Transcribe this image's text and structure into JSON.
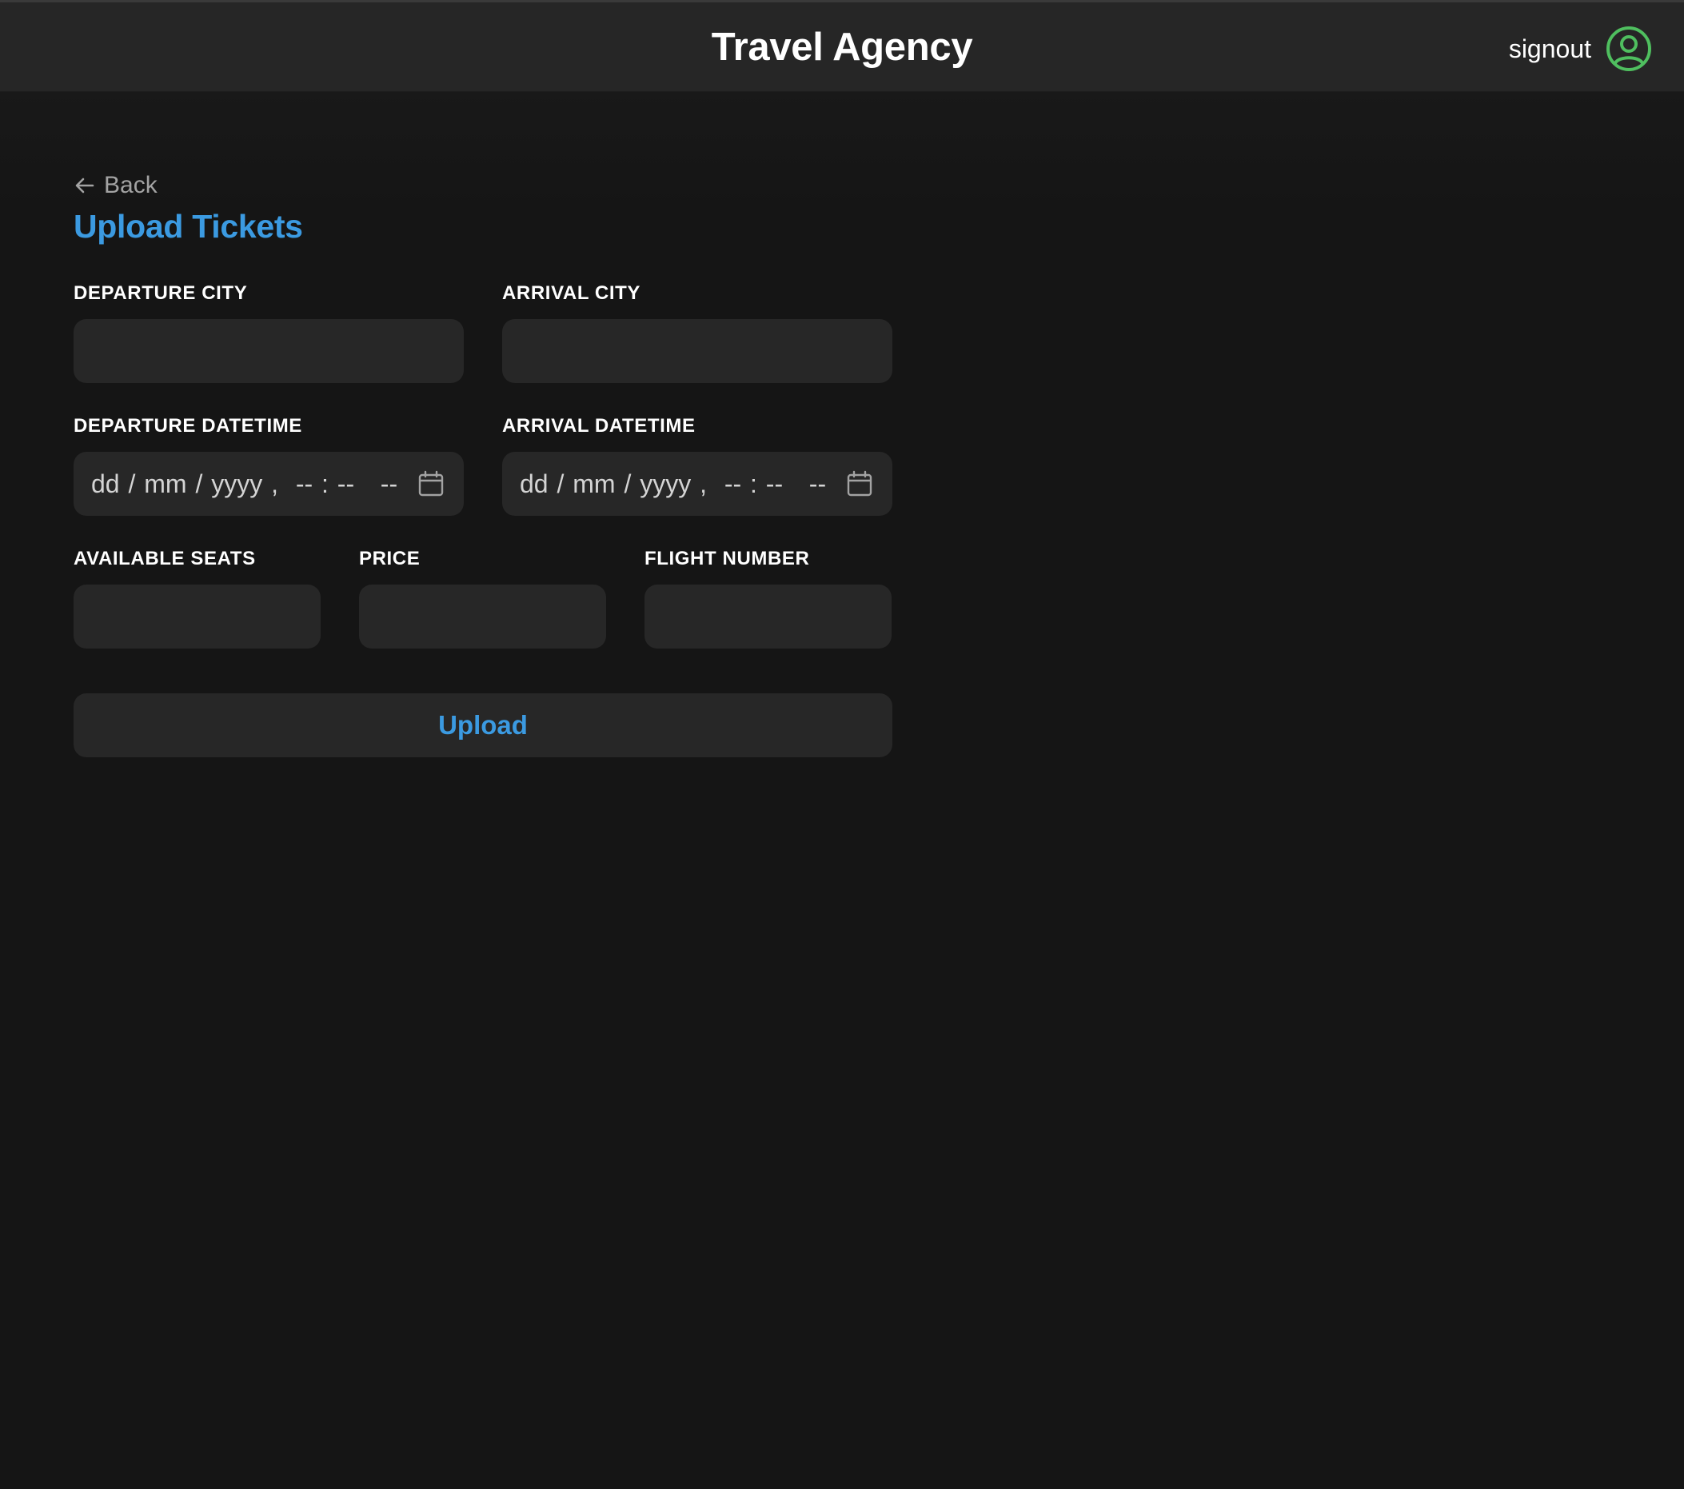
{
  "header": {
    "title": "Travel Agency",
    "signout_label": "signout",
    "user_icon": "user-circle-icon",
    "user_icon_color": "#4fbf5f"
  },
  "nav": {
    "back_label": "Back",
    "back_icon": "arrow-left-icon"
  },
  "page": {
    "title": "Upload Tickets",
    "accent_color": "#3b9ae1"
  },
  "form": {
    "departure_city": {
      "label": "DEPARTURE CITY",
      "value": ""
    },
    "arrival_city": {
      "label": "ARRIVAL CITY",
      "value": ""
    },
    "departure_datetime": {
      "label": "DEPARTURE DATETIME",
      "placeholder": "dd / mm / yyyy ,  -- : --   --"
    },
    "arrival_datetime": {
      "label": "ARRIVAL DATETIME",
      "placeholder": "dd / mm / yyyy ,  -- : --   --"
    },
    "available_seats": {
      "label": "AVAILABLE SEATS",
      "value": ""
    },
    "price": {
      "label": "PRICE",
      "value": ""
    },
    "flight_number": {
      "label": "FLIGHT NUMBER",
      "value": ""
    },
    "submit_label": "Upload"
  }
}
